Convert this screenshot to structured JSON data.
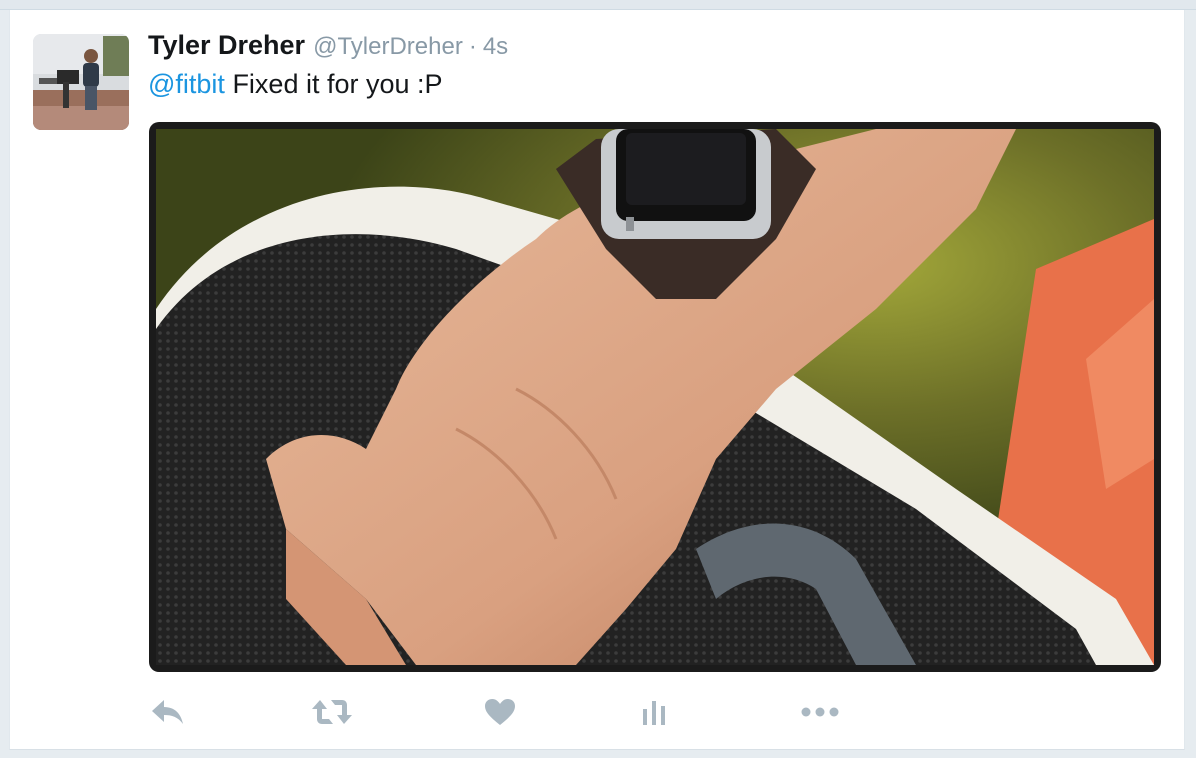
{
  "tweet": {
    "fullname": "Tyler Dreher",
    "username": "@TylerDreher",
    "separator": "·",
    "timestamp": "4s",
    "mention": "@fitbit",
    "text": " Fixed it for you :P"
  },
  "actions": [
    {
      "name": "reply-icon"
    },
    {
      "name": "retweet-icon"
    },
    {
      "name": "like-icon"
    },
    {
      "name": "analytics-icon"
    },
    {
      "name": "more-icon"
    }
  ],
  "colors": {
    "mention": "#1b95e0",
    "action_icon": "#aab8c2",
    "name": "#14171a",
    "secondary": "#8899a6"
  }
}
